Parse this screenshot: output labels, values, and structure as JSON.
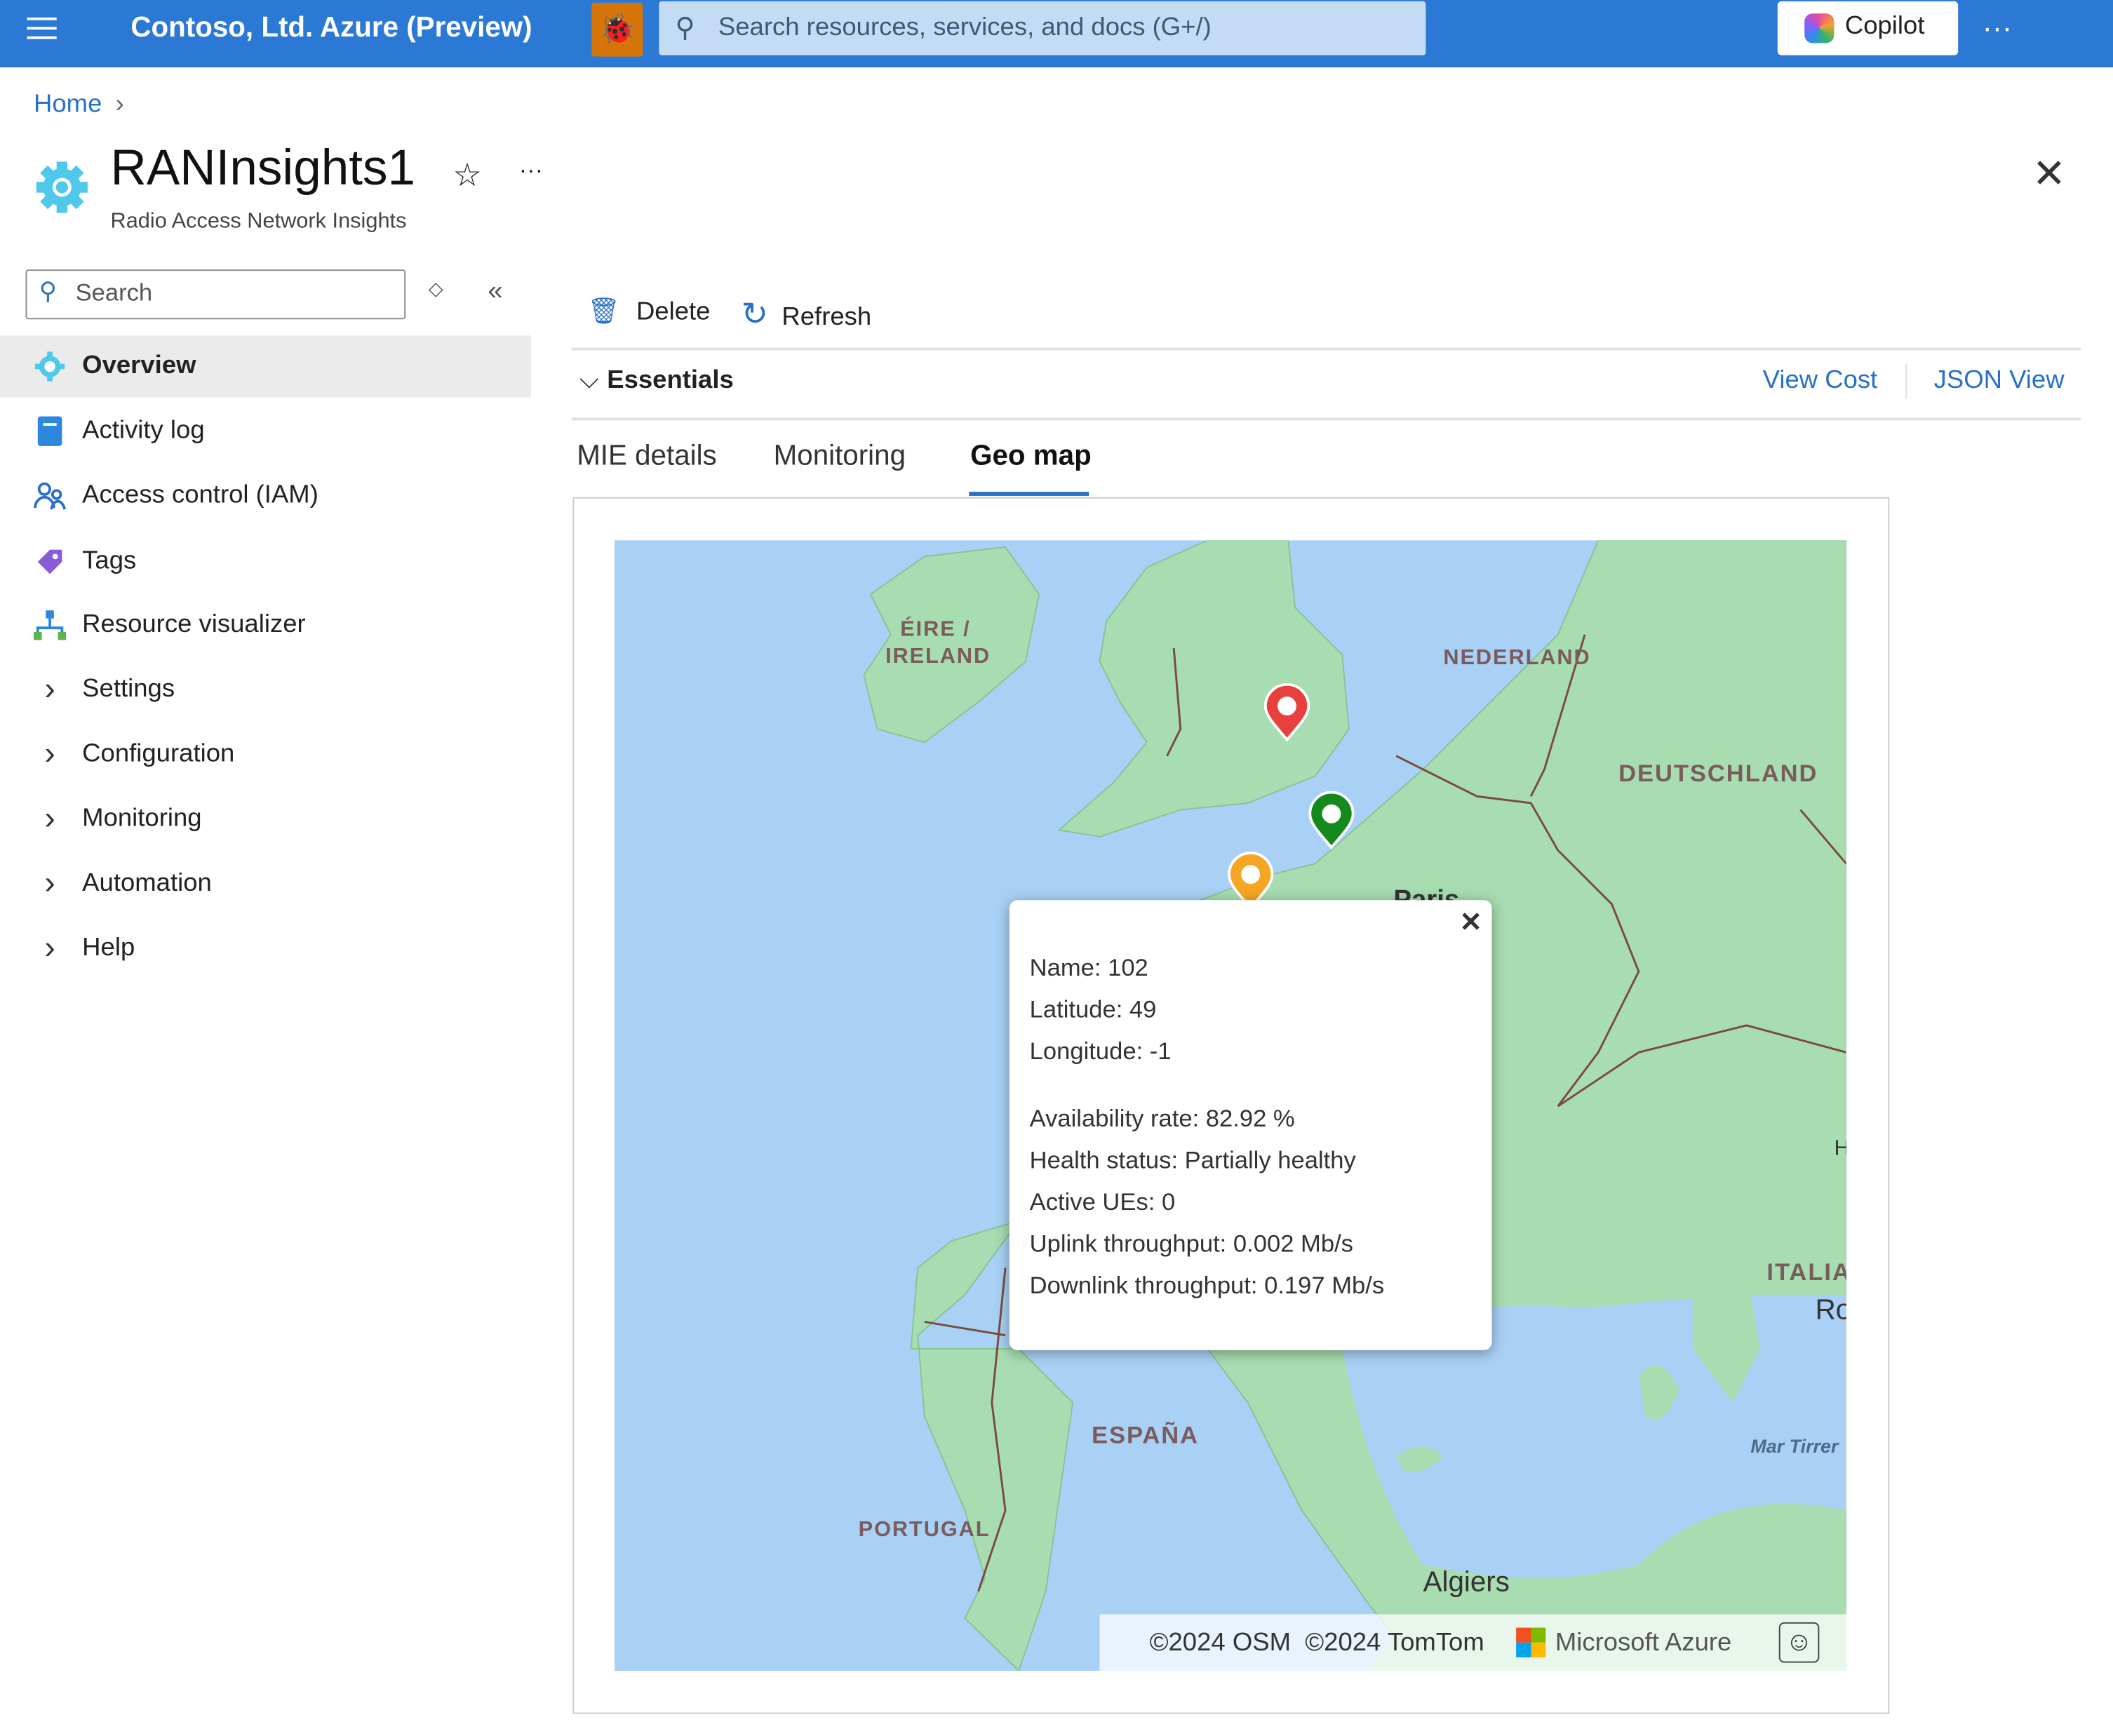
{
  "topbar": {
    "title": "Contoso, Ltd. Azure (Preview)",
    "search_placeholder": "Search resources, services, and docs (G+/)",
    "copilot": "Copilot",
    "more": "···"
  },
  "breadcrumb": {
    "home": "Home"
  },
  "resource": {
    "name": "RANInsights1",
    "type": "Radio Access Network Insights",
    "more": "···"
  },
  "sidebar": {
    "search_placeholder": "Search",
    "items": [
      {
        "label": "Overview",
        "icon": "gear-icon",
        "selected": true
      },
      {
        "label": "Activity log",
        "icon": "log-icon"
      },
      {
        "label": "Access control (IAM)",
        "icon": "people-icon"
      },
      {
        "label": "Tags",
        "icon": "tag-icon"
      },
      {
        "label": "Resource visualizer",
        "icon": "hierarchy-icon"
      },
      {
        "label": "Settings",
        "icon": "chevron-right-icon"
      },
      {
        "label": "Configuration",
        "icon": "chevron-right-icon"
      },
      {
        "label": "Monitoring",
        "icon": "chevron-right-icon"
      },
      {
        "label": "Automation",
        "icon": "chevron-right-icon"
      },
      {
        "label": "Help",
        "icon": "chevron-right-icon"
      }
    ]
  },
  "toolbar": {
    "delete": "Delete",
    "refresh": "Refresh"
  },
  "essentials": {
    "label": "Essentials",
    "view_cost": "View Cost",
    "json_view": "JSON View"
  },
  "tabs": [
    {
      "label": "MIE details"
    },
    {
      "label": "Monitoring"
    },
    {
      "label": "Geo map",
      "active": true
    }
  ],
  "map": {
    "labels": {
      "ireland1": "ÉIRE /",
      "ireland2": "IRELAND",
      "netherlands": "NEDERLAND",
      "germany": "DEUTSCHLAND",
      "paris": "Paris",
      "italy": "ITALIA",
      "rome": "Ro",
      "spain": "ESPAÑA",
      "portugal": "PORTUGAL",
      "tyrrhenian": "Mar Tirrer",
      "algiers": "Algiers",
      "h": "H"
    },
    "pins": [
      {
        "color": "#e8403d",
        "status": "unhealthy"
      },
      {
        "color": "#138a1b",
        "status": "healthy"
      },
      {
        "color": "#f5a623",
        "status": "partially healthy"
      }
    ],
    "popup": {
      "name": "Name: 102",
      "latitude": "Latitude: 49",
      "longitude": "Longitude: -1",
      "availability": "Availability rate: 82.92 %",
      "health": "Health status: Partially healthy",
      "active_ues": "Active UEs: 0",
      "uplink": "Uplink throughput: 0.002 Mb/s",
      "downlink": "Downlink throughput: 0.197 Mb/s"
    },
    "attribution": {
      "copyright": "©2024 OSM  ©2024 TomTom",
      "brand": "Microsoft Azure"
    }
  }
}
